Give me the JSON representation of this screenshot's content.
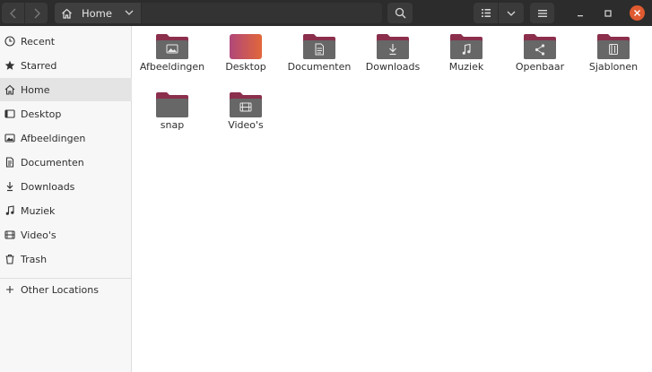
{
  "header": {
    "path_label": "Home"
  },
  "sidebar": {
    "items": [
      {
        "label": "Recent",
        "icon": "clock-icon"
      },
      {
        "label": "Starred",
        "icon": "star-icon"
      },
      {
        "label": "Home",
        "icon": "home-icon",
        "active": true
      },
      {
        "label": "Desktop",
        "icon": "desktop-icon"
      },
      {
        "label": "Afbeeldingen",
        "icon": "image-icon"
      },
      {
        "label": "Documenten",
        "icon": "document-icon"
      },
      {
        "label": "Downloads",
        "icon": "download-icon"
      },
      {
        "label": "Muziek",
        "icon": "music-icon"
      },
      {
        "label": "Video's",
        "icon": "video-icon"
      },
      {
        "label": "Trash",
        "icon": "trash-icon"
      }
    ],
    "other_locations": "Other Locations"
  },
  "files": [
    {
      "label": "Afbeeldingen",
      "icon": "image-icon"
    },
    {
      "label": "Desktop",
      "icon": "desktop-folder-icon"
    },
    {
      "label": "Documenten",
      "icon": "document-icon"
    },
    {
      "label": "Downloads",
      "icon": "download-icon"
    },
    {
      "label": "Muziek",
      "icon": "music-icon"
    },
    {
      "label": "Openbaar",
      "icon": "share-icon"
    },
    {
      "label": "Sjablonen",
      "icon": "template-icon"
    },
    {
      "label": "snap",
      "icon": "folder-icon"
    },
    {
      "label": "Video's",
      "icon": "video-icon"
    }
  ],
  "colors": {
    "headerbar": "#2c2c2c",
    "folder_tab": "#8b2f4c",
    "folder_body": "#676767",
    "close_button": "#e05a30",
    "desktop_gradient_start": "#b0477a",
    "desktop_gradient_end": "#e2673a"
  }
}
